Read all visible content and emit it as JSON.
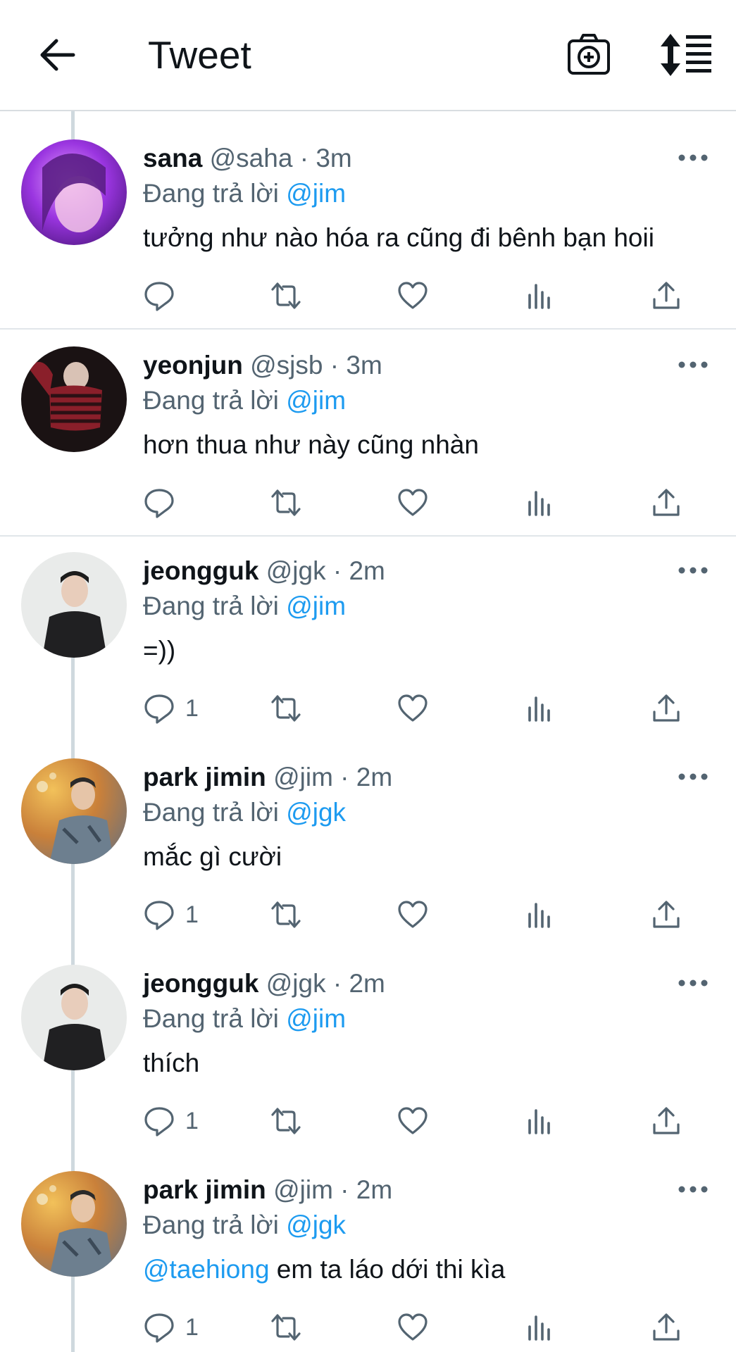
{
  "header": {
    "title": "Tweet"
  },
  "reply_prefix": "Đang trả lời",
  "tweets": [
    {
      "name": "sana",
      "handle": "@saha",
      "sep": "·",
      "time": "3m",
      "reply_to": "@jim",
      "mention": "",
      "text": "tưởng như nào hóa ra cũng đi bênh bạn hoii",
      "reply_count": ""
    },
    {
      "name": "yeonjun",
      "handle": "@sjsb",
      "sep": "·",
      "time": "3m",
      "reply_to": "@jim",
      "mention": "",
      "text": "hơn thua như này cũng nhàn",
      "reply_count": ""
    },
    {
      "name": "jeongguk",
      "handle": "@jgk",
      "sep": "·",
      "time": "2m",
      "reply_to": "@jim",
      "mention": "",
      "text": "=))",
      "reply_count": "1"
    },
    {
      "name": "park jimin",
      "handle": "@jim",
      "sep": "·",
      "time": "2m",
      "reply_to": "@jgk",
      "mention": "",
      "text": "mắc gì cười",
      "reply_count": "1"
    },
    {
      "name": "jeongguk",
      "handle": "@jgk",
      "sep": "·",
      "time": "2m",
      "reply_to": "@jim",
      "mention": "",
      "text": "thích",
      "reply_count": "1"
    },
    {
      "name": "park jimin",
      "handle": "@jim",
      "sep": "·",
      "time": "2m",
      "reply_to": "@jgk",
      "mention": "@taehiong",
      "text": " em ta láo dới thi kìa",
      "reply_count": "1"
    }
  ],
  "icons": {
    "header": [
      "back-arrow-icon",
      "camera-plus-icon",
      "sort-icon"
    ],
    "actions": [
      "reply-icon",
      "retweet-icon",
      "like-icon",
      "analytics-icon",
      "share-icon"
    ],
    "more": "more-horizontal-icon"
  },
  "colors": {
    "link": "#1d9bf0",
    "text": "#0f1419",
    "muted": "#536471",
    "divider": "#e1e6ea"
  }
}
